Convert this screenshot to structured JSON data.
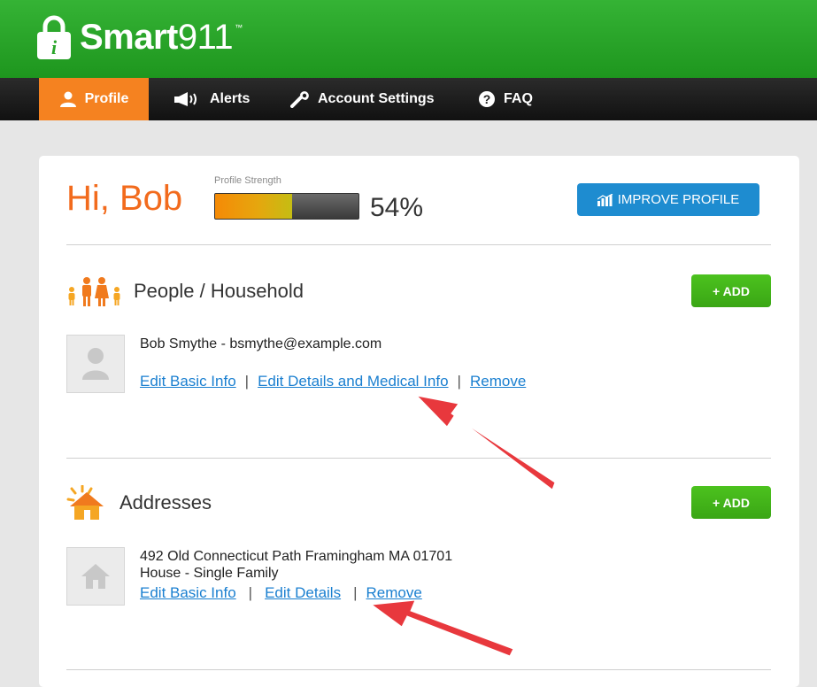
{
  "brand": {
    "name": "Smart",
    "number": "911",
    "trademark": "™"
  },
  "nav": {
    "items": [
      {
        "label": "Profile",
        "icon": "person-icon"
      },
      {
        "label": "Alerts",
        "icon": "megaphone-icon"
      },
      {
        "label": "Account Settings",
        "icon": "wrench-icon"
      },
      {
        "label": "FAQ",
        "icon": "question-icon"
      }
    ],
    "active": "Profile"
  },
  "header": {
    "greeting": "Hi, Bob",
    "strength_label": "Profile Strength",
    "strength_value": "54%",
    "strength_fraction": 0.54,
    "improve_label": "IMPROVE PROFILE"
  },
  "people": {
    "title": "People / Household",
    "add_label": "+ ADD",
    "entry": "Bob Smythe - bsmythe@example.com",
    "links": [
      "Edit Basic Info",
      "Edit Details and Medical Info",
      "Remove"
    ],
    "separator": "|"
  },
  "addresses": {
    "title": "Addresses",
    "add_label": "+ ADD",
    "line1": "492 Old Connecticut Path Framingham MA 01701",
    "line2": "House - Single Family",
    "links": [
      "Edit Basic Info",
      "Edit Details",
      "Remove"
    ],
    "separator": "|"
  },
  "colors": {
    "brand_green": "#2aa52a",
    "nav_active": "#f58220",
    "greeting": "#f26b1d",
    "improve_button": "#1e8cd0",
    "add_button": "#42b41a",
    "link": "#1a7fd0",
    "annotation_arrow": "#e8383d"
  }
}
